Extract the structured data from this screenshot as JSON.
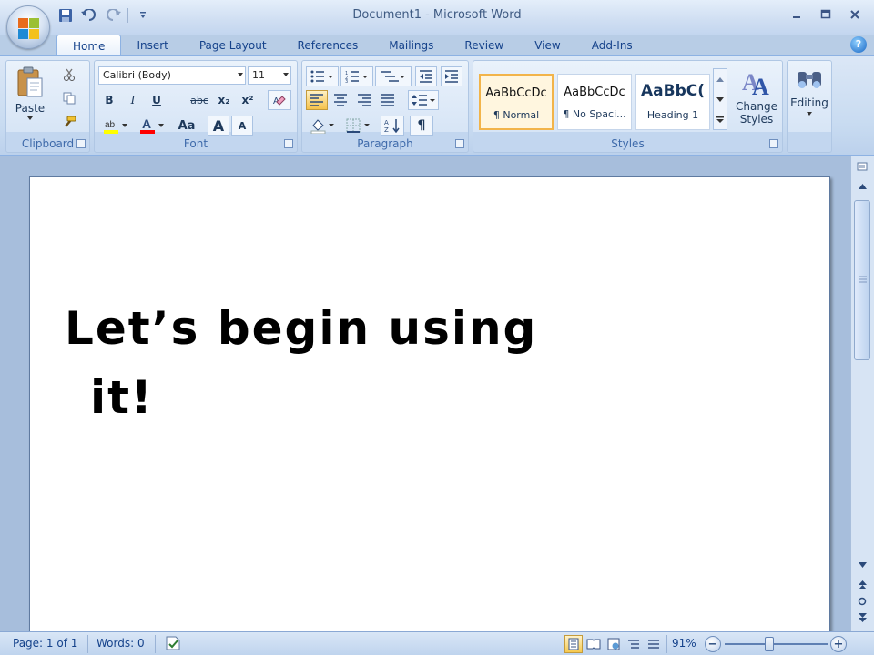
{
  "window": {
    "title": "Document1 - Microsoft Word"
  },
  "quick_access": {
    "icons": [
      "save-icon",
      "undo-icon",
      "redo-icon",
      "customize-icon"
    ]
  },
  "tabs": [
    {
      "label": "Home",
      "active": true
    },
    {
      "label": "Insert"
    },
    {
      "label": "Page Layout"
    },
    {
      "label": "References"
    },
    {
      "label": "Mailings"
    },
    {
      "label": "Review"
    },
    {
      "label": "View"
    },
    {
      "label": "Add-Ins"
    }
  ],
  "help_label": "?",
  "ribbon": {
    "clipboard": {
      "label": "Clipboard",
      "paste_label": "Paste"
    },
    "font": {
      "label": "Font",
      "font_name": "Calibri (Body)",
      "font_size": "11",
      "bold": "B",
      "italic": "I",
      "underline": "U",
      "strike": "abc",
      "subscript": "x₂",
      "superscript": "x²",
      "grow": "A",
      "shrink": "A",
      "case": "Aa"
    },
    "paragraph": {
      "label": "Paragraph",
      "pilcrow": "¶"
    },
    "styles": {
      "label": "Styles",
      "items": [
        {
          "sample": "AaBbCcDc",
          "name": "¶ Normal",
          "selected": true
        },
        {
          "sample": "AaBbCcDc",
          "name": "¶ No Spaci..."
        },
        {
          "sample": "AaBbC(",
          "name": "Heading 1"
        }
      ],
      "change_styles_label": "Change Styles"
    },
    "editing": {
      "label": "Editing"
    }
  },
  "document": {
    "lines": [
      "Let’s begin using",
      "it!"
    ]
  },
  "status": {
    "page": "Page: 1 of 1",
    "words": "Words: 0",
    "zoom": "91%"
  },
  "colors": {
    "ribbon_bg": "#c8dbf1",
    "highlight": "#ffff00",
    "font_color": "#ff0000",
    "selected_style": "#f2b44a"
  }
}
